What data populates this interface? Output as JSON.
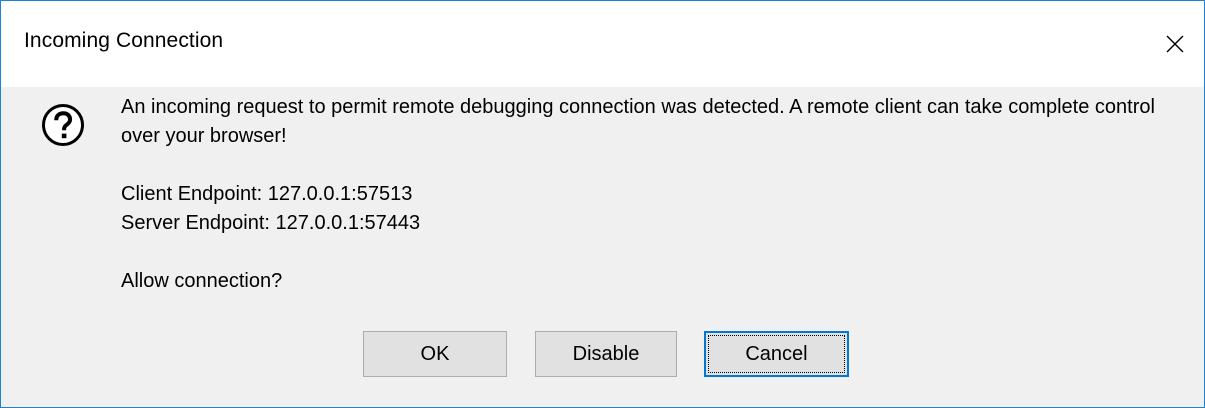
{
  "window": {
    "title": "Incoming Connection",
    "close_glyph": "×"
  },
  "icon": {
    "name": "question-icon"
  },
  "message": {
    "warning": "An incoming request to permit remote debugging connection was detected. A remote client can take complete control over your browser!",
    "client_endpoint": "Client Endpoint: 127.0.0.1:57513",
    "server_endpoint": "Server Endpoint: 127.0.0.1:57443",
    "prompt": "Allow connection?"
  },
  "buttons": {
    "ok": "OK",
    "disable": "Disable",
    "cancel": "Cancel",
    "focused": "cancel"
  },
  "colors": {
    "accent": "#0078d7",
    "window_border": "#1883d7",
    "dialog_bg": "#f0f0f0",
    "titlebar_bg": "#ffffff",
    "button_bg": "#e1e1e1"
  }
}
